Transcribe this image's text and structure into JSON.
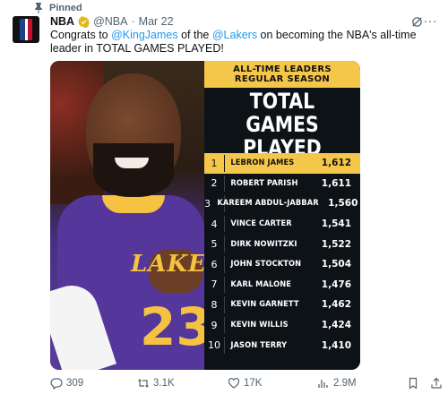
{
  "pinned_label": "Pinned",
  "tweet": {
    "author_name": "NBA",
    "handle": "@NBA",
    "separator": "·",
    "date": "Mar 22",
    "text_parts": {
      "p1": "Congrats to ",
      "mention1": "@KingJames",
      "p2": " of the ",
      "mention2": "@Lakers",
      "p3": " on becoming the NBA's all-time leader in TOTAL GAMES PLAYED!"
    }
  },
  "graphic": {
    "banner_line1": "ALL-TIME LEADERS",
    "banner_line2": "REGULAR SEASON",
    "title_line1": "TOTAL",
    "title_line2": "GAMES PLAYED",
    "jersey_word": "LAKERS",
    "jersey_number": "23",
    "leaders": [
      {
        "rank": "1",
        "player": "LEBRON JAMES",
        "games": "1,612"
      },
      {
        "rank": "2",
        "player": "ROBERT PARISH",
        "games": "1,611"
      },
      {
        "rank": "3",
        "player": "KAREEM ABDUL-JABBAR",
        "games": "1,560"
      },
      {
        "rank": "4",
        "player": "VINCE CARTER",
        "games": "1,541"
      },
      {
        "rank": "5",
        "player": "DIRK NOWITZKI",
        "games": "1,522"
      },
      {
        "rank": "6",
        "player": "JOHN STOCKTON",
        "games": "1,504"
      },
      {
        "rank": "7",
        "player": "KARL MALONE",
        "games": "1,476"
      },
      {
        "rank": "8",
        "player": "KEVIN GARNETT",
        "games": "1,462"
      },
      {
        "rank": "9",
        "player": "KEVIN WILLIS",
        "games": "1,424"
      },
      {
        "rank": "10",
        "player": "JASON TERRY",
        "games": "1,410"
      }
    ]
  },
  "actions": {
    "replies": "309",
    "reposts": "3.1K",
    "likes": "17K",
    "views": "2.9M"
  },
  "colors": {
    "accent": "#1d9bf0",
    "banner_gold": "#f4c64a",
    "board_bg": "#0d1217",
    "lakers_purple": "#55379b"
  },
  "icons": [
    "pin-icon",
    "nba-logo",
    "verified-icon",
    "grok-icon",
    "more-icon",
    "reply-icon",
    "retweet-icon",
    "like-icon",
    "views-icon",
    "bookmark-icon",
    "share-icon"
  ]
}
